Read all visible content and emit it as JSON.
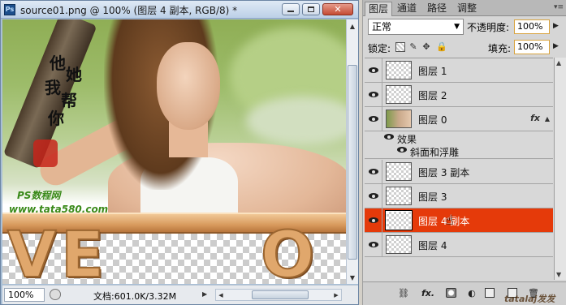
{
  "document": {
    "title": "source01.png @ 100% (图层 4 副本, RGB/8) *",
    "app_logo": "Ps",
    "watermark_chars": [
      "他",
      "她",
      "我",
      "帮",
      "你"
    ],
    "watermark_tag": "PS数程网",
    "watermark_url": "www.tata580.com",
    "zoom": "100%",
    "doc_size": "文档:601.0K/3.32M"
  },
  "panel": {
    "tabs": [
      {
        "label": "图层",
        "active": true
      },
      {
        "label": "通道",
        "active": false
      },
      {
        "label": "路径",
        "active": false
      },
      {
        "label": "调整",
        "active": false
      }
    ],
    "blend_mode": "正常",
    "opacity_label": "不透明度:",
    "opacity_value": "100%",
    "lock_label": "锁定:",
    "fill_label": "填充:",
    "fill_value": "100%",
    "layers": [
      {
        "name": "图层 1",
        "thumb": "transparent",
        "selected": false
      },
      {
        "name": "图层 2",
        "thumb": "transparent",
        "selected": false
      },
      {
        "name": "图层 0",
        "thumb": "photo",
        "selected": false,
        "fx": "fx"
      },
      {
        "name": "图层 3 副本",
        "thumb": "transparent",
        "selected": false
      },
      {
        "name": "图层 3",
        "thumb": "transparent",
        "selected": false
      },
      {
        "name": "图层 4 副本",
        "thumb": "transparent",
        "selected": true
      },
      {
        "name": "图层 4",
        "thumb": "transparent",
        "selected": false
      }
    ],
    "effects": {
      "group_label": "效果",
      "items": [
        "斜面和浮雕"
      ]
    },
    "bottom_watermark": "tatalaj发发"
  },
  "colors": {
    "selection": "#e53a0a",
    "panel_bg": "#d6d6d6",
    "field_border": "#d8a440"
  }
}
